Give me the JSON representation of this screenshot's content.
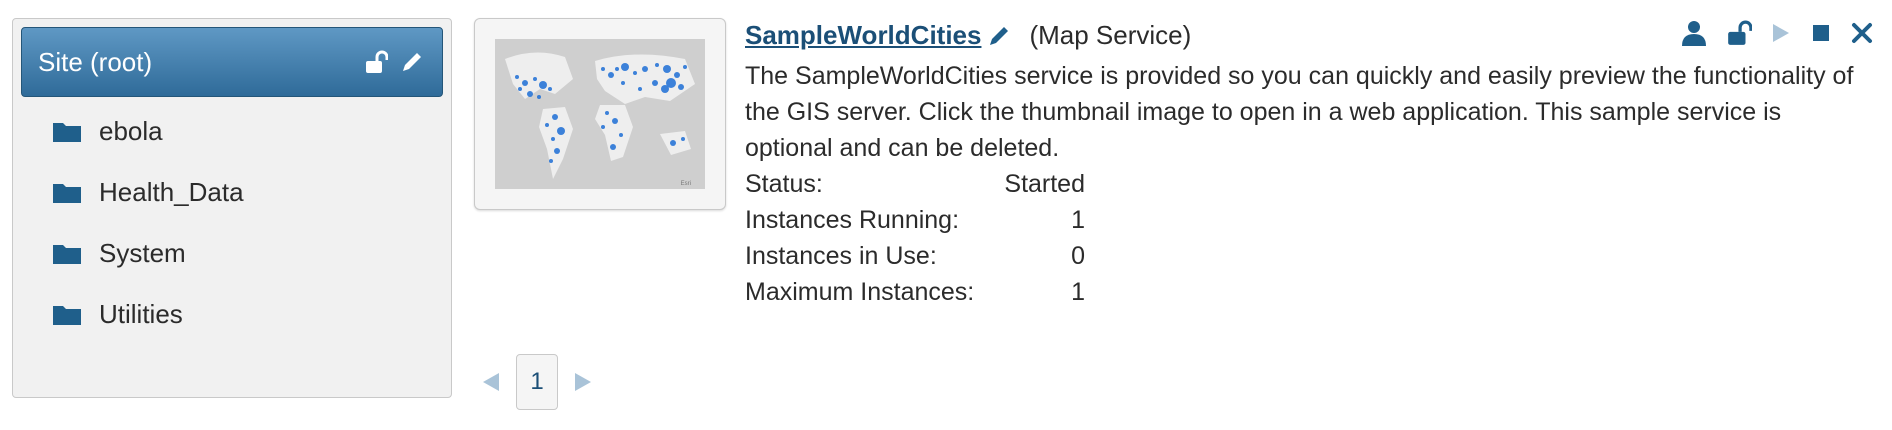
{
  "sidebar": {
    "root_label": "Site (root)",
    "items": [
      {
        "label": "ebola",
        "icon": "folder-icon"
      },
      {
        "label": "Health_Data",
        "icon": "folder-icon"
      },
      {
        "label": "System",
        "icon": "folder-icon"
      },
      {
        "label": "Utilities",
        "icon": "folder-icon"
      }
    ]
  },
  "service": {
    "name": "SampleWorldCities",
    "type": "(Map Service)",
    "description": "The SampleWorldCities service is provided so you can quickly and easily preview the functionality of the GIS server. Click the thumbnail image to open in a web application. This sample service is optional and can be deleted.",
    "thumbnail_watermark": "Esri",
    "info": [
      {
        "label": "Status:",
        "value": "Started"
      },
      {
        "label": "Instances Running:",
        "value": "1"
      },
      {
        "label": "Instances in Use:",
        "value": "0"
      },
      {
        "label": "Maximum Instances:",
        "value": "1"
      }
    ]
  },
  "pagination": {
    "current_page": "1"
  },
  "colors": {
    "accent": "#2f6b99",
    "link": "#1b4f77",
    "icon": "#1f5f8b"
  }
}
